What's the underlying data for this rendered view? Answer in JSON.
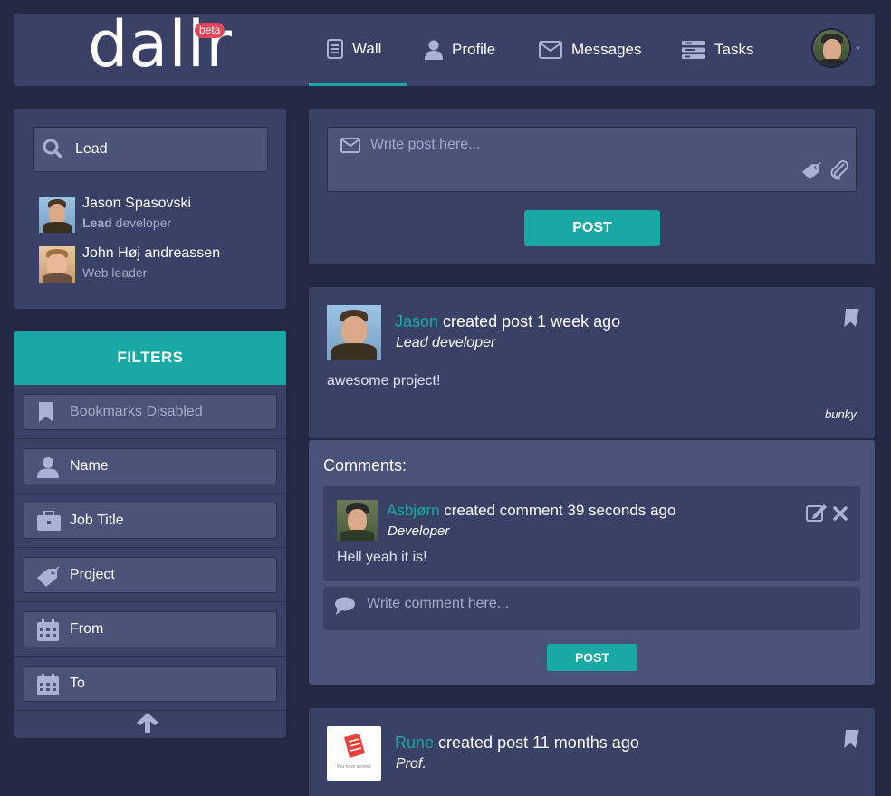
{
  "app": {
    "logo": "dallr",
    "badge": "beta"
  },
  "nav": {
    "items": [
      {
        "label": "Wall",
        "icon": "document-icon",
        "active": true
      },
      {
        "label": "Profile",
        "icon": "person-icon"
      },
      {
        "label": "Messages",
        "icon": "envelope-icon"
      },
      {
        "label": "Tasks",
        "icon": "tasks-icon"
      }
    ],
    "user_menu_caret": "⌄"
  },
  "search": {
    "value": "Lead",
    "results": [
      {
        "name": "Jason Spasovski",
        "sub_bold": "Lead",
        "sub_rest": " developer"
      },
      {
        "name": "John Høj andreassen",
        "sub_bold": "",
        "sub_rest": "Web leader"
      }
    ]
  },
  "filters": {
    "title": "FILTERS",
    "items": [
      {
        "label": "Bookmarks Disabled",
        "icon": "bookmark-icon",
        "disabled": true
      },
      {
        "label": "Name",
        "icon": "person-icon"
      },
      {
        "label": "Job Title",
        "icon": "briefcase-icon"
      },
      {
        "label": "Project",
        "icon": "tag-icon"
      },
      {
        "label": "From",
        "icon": "calendar-icon"
      },
      {
        "label": "To",
        "icon": "calendar-icon"
      }
    ]
  },
  "composer": {
    "placeholder": "Write post here...",
    "post_label": "POST"
  },
  "posts": [
    {
      "author": "Jason",
      "action": " created post 1 week ago",
      "role": "Lead developer",
      "body": "awesome project!",
      "tag": "bunky",
      "comments_label": "Comments:",
      "comments": [
        {
          "author": "Asbjørn",
          "action": " created comment 39 seconds ago",
          "role": "Developer",
          "body": "Hell yeah it is!"
        }
      ],
      "comment_placeholder": "Write comment here...",
      "comment_post_label": "POST"
    },
    {
      "author": "Rune",
      "action": " created post 11 months ago",
      "role": "Prof.",
      "logo_caption": "You have arrived."
    }
  ],
  "colors": {
    "accent": "#18a8a5",
    "background": "#232943",
    "panel": "#3a4166",
    "badge": "#e0475c"
  }
}
